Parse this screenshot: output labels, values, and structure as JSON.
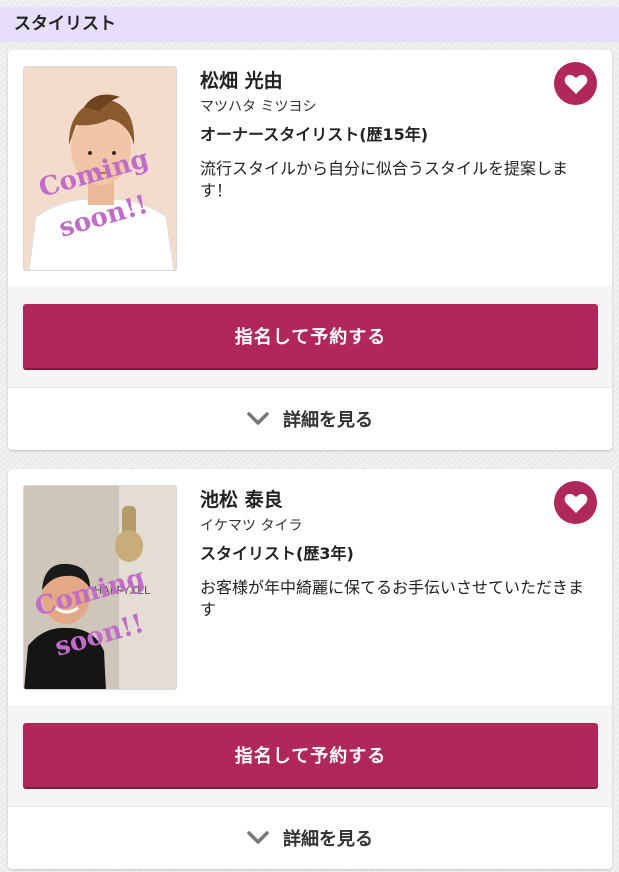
{
  "section": {
    "title": "スタイリスト"
  },
  "stylists": [
    {
      "name": "松畑 光由",
      "kana": "マツハタ ミツヨシ",
      "title": "オーナースタイリスト(歴15年)",
      "message": "流行スタイルから自分に似合うスタイルを提案します！",
      "photo_overlay": "Coming soon!!",
      "reserve_label": "指名して予約する",
      "detail_label": "詳細を見る"
    },
    {
      "name": "池松 泰良",
      "kana": "イケマツ タイラ",
      "title": "スタイリスト(歴3年)",
      "message": "お客様が年中綺麗に保てるお手伝いさせていただきます",
      "photo_overlay": "Coming soon!!",
      "reserve_label": "指名して予約する",
      "detail_label": "詳細を見る"
    }
  ],
  "colors": {
    "accent": "#b0285a",
    "header_bg": "#e6defa",
    "overlay_text": "#c06cc8"
  },
  "icons": {
    "favorite": "heart-icon",
    "expand": "chevron-down-icon"
  }
}
